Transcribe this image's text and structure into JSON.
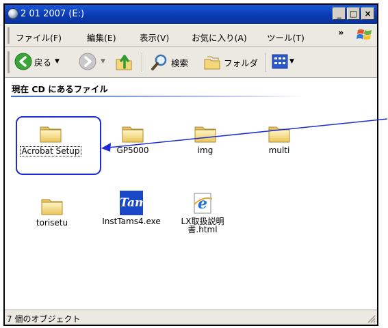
{
  "window": {
    "title": "2 01 2007 (E:)"
  },
  "title_buttons": [
    "_",
    "□",
    "×"
  ],
  "menu": [
    "ファイル(F)",
    "編集(E)",
    "表示(V)",
    "お気に入り(A)",
    "ツール(T)"
  ],
  "menu_overflow": "»",
  "toolbar": {
    "back_label": "戻る",
    "search_label": "検索",
    "folders_label": "フォルダ"
  },
  "group": {
    "title": "現在 CD にあるファイル"
  },
  "files": [
    {
      "name": "Acrobat Setup",
      "type": "folder",
      "selected": true
    },
    {
      "name": "GP5000",
      "type": "folder"
    },
    {
      "name": "img",
      "type": "folder"
    },
    {
      "name": "multi",
      "type": "folder"
    },
    {
      "name": "torisetu",
      "type": "folder"
    },
    {
      "name": "InstTams4.exe",
      "type": "exe",
      "icon_text": "Tam"
    },
    {
      "name_line1": "LX取扱説明",
      "name_line2": "書.html",
      "type": "html"
    }
  ],
  "status": {
    "text": "7 個のオブジェクト"
  },
  "colors": {
    "titlebar": "#0a3bb3",
    "annotation": "#1d2bd6",
    "folder": "#f3d77a"
  }
}
